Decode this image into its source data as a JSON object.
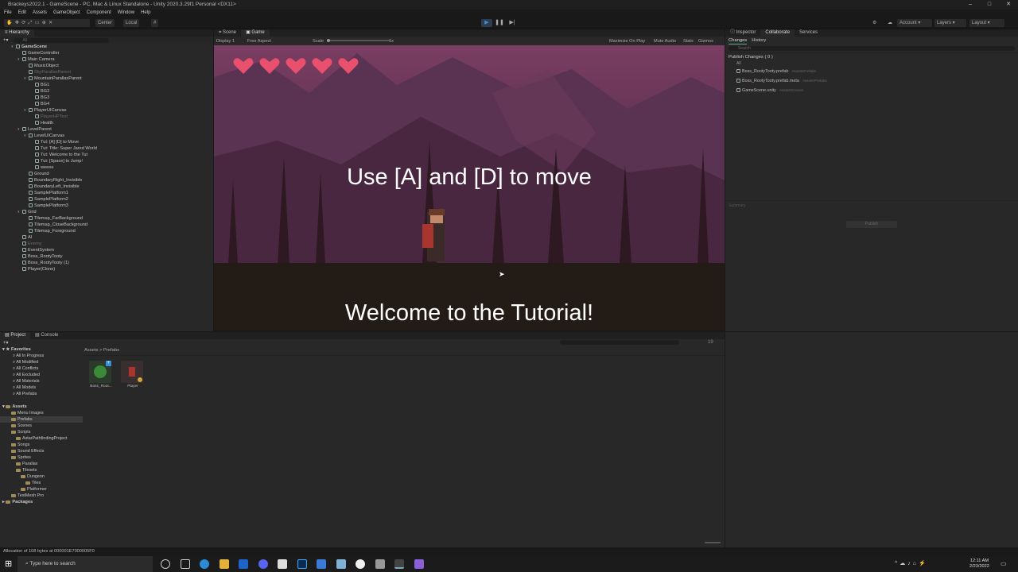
{
  "window": {
    "title": "Brackeys2022.1 - GameScene - PC, Mac & Linux Standalone - Unity 2020.3.29f1 Personal <DX11>",
    "controls": [
      "–",
      "□",
      "✕"
    ]
  },
  "menu": [
    "File",
    "Edit",
    "Assets",
    "GameObject",
    "Component",
    "Window",
    "Help"
  ],
  "toolbar": {
    "pivot": "Center",
    "space": "Local",
    "account": "Account",
    "layers": "Layers",
    "layout": "Layout"
  },
  "hierarchy": {
    "tab": "Hierarchy",
    "search_placeholder": "All",
    "items": [
      {
        "label": "GameScene",
        "indent": 0,
        "kind": "scene",
        "dim": false
      },
      {
        "label": "GameController",
        "indent": 1,
        "kind": "obj",
        "dim": false
      },
      {
        "label": "Main Camera",
        "indent": 1,
        "kind": "obj",
        "dim": false,
        "caret": true
      },
      {
        "label": "MusicObject",
        "indent": 2,
        "kind": "obj",
        "dim": false
      },
      {
        "label": "SkyParallaxParent",
        "indent": 2,
        "kind": "obj",
        "dim": true
      },
      {
        "label": "MountainParallaxParent",
        "indent": 2,
        "kind": "obj",
        "dim": false,
        "caret": true
      },
      {
        "label": "BG1",
        "indent": 3,
        "kind": "obj",
        "dim": false
      },
      {
        "label": "BG2",
        "indent": 3,
        "kind": "obj",
        "dim": false
      },
      {
        "label": "BG3",
        "indent": 3,
        "kind": "obj",
        "dim": false
      },
      {
        "label": "BG4",
        "indent": 3,
        "kind": "obj",
        "dim": false
      },
      {
        "label": "PlayerUICanvas",
        "indent": 2,
        "kind": "obj",
        "dim": false,
        "caret": true
      },
      {
        "label": "PlayerHPText",
        "indent": 3,
        "kind": "obj",
        "dim": true
      },
      {
        "label": "Health",
        "indent": 3,
        "kind": "obj",
        "dim": false
      },
      {
        "label": "LevelParent",
        "indent": 1,
        "kind": "obj",
        "dim": false,
        "caret": true
      },
      {
        "label": "LevelUICanvas",
        "indent": 2,
        "kind": "obj",
        "dim": false,
        "caret": true
      },
      {
        "label": "Tut: [A] [D] to Move",
        "indent": 3,
        "kind": "obj",
        "dim": false
      },
      {
        "label": "Tut: Title: Super Jared World",
        "indent": 3,
        "kind": "obj",
        "dim": false
      },
      {
        "label": "Tut: Welcome to the Tut",
        "indent": 3,
        "kind": "obj",
        "dim": false
      },
      {
        "label": "Tut: [Space] to Jump!",
        "indent": 3,
        "kind": "obj",
        "dim": false
      },
      {
        "label": "weeee",
        "indent": 3,
        "kind": "obj",
        "dim": false
      },
      {
        "label": "Ground",
        "indent": 2,
        "kind": "obj",
        "dim": false
      },
      {
        "label": "BoundaryRight_Invisible",
        "indent": 2,
        "kind": "obj",
        "dim": false
      },
      {
        "label": "BoundaryLeft_Invisible",
        "indent": 2,
        "kind": "obj",
        "dim": false
      },
      {
        "label": "SamplePlatform1",
        "indent": 2,
        "kind": "obj",
        "dim": false
      },
      {
        "label": "SamplePlatform2",
        "indent": 2,
        "kind": "obj",
        "dim": false
      },
      {
        "label": "SamplePlatform3",
        "indent": 2,
        "kind": "obj",
        "dim": false
      },
      {
        "label": "Grid",
        "indent": 1,
        "kind": "obj",
        "dim": false,
        "caret": true
      },
      {
        "label": "Tilemap_FarBackground",
        "indent": 2,
        "kind": "obj",
        "dim": false
      },
      {
        "label": "Tilemap_CloseBackground",
        "indent": 2,
        "kind": "obj",
        "dim": false
      },
      {
        "label": "Tilemap_Foreground",
        "indent": 2,
        "kind": "obj",
        "dim": false
      },
      {
        "label": "AI",
        "indent": 1,
        "kind": "obj",
        "dim": false
      },
      {
        "label": "Enemy",
        "indent": 1,
        "kind": "obj",
        "dim": true
      },
      {
        "label": "EventSystem",
        "indent": 1,
        "kind": "obj",
        "dim": false
      },
      {
        "label": "Boss_RootyTooty",
        "indent": 1,
        "kind": "obj",
        "dim": false
      },
      {
        "label": "Boss_RootyTooty (1)",
        "indent": 1,
        "kind": "obj",
        "dim": false
      },
      {
        "label": "Player(Clone)",
        "indent": 1,
        "kind": "obj",
        "dim": false
      }
    ]
  },
  "view_tabs": [
    "Scene",
    "Game"
  ],
  "game_bar": {
    "display": "Display 1",
    "aspect": "Free Aspect",
    "scale_label": "Scale",
    "scale_value": "1x",
    "maximize": "Maximize On Play",
    "mute": "Mute Audio",
    "stats": "Stats",
    "gizmos": "Gizmos"
  },
  "game": {
    "line1": "Use [A] and [D] to move",
    "line2": "Welcome to the Tutorial!",
    "hearts": 5
  },
  "inspector": {
    "tabs": [
      "Inspector",
      "Collaborate",
      "Services"
    ],
    "subtabs": [
      "Changes",
      "History"
    ],
    "search_placeholder": "Search",
    "publish": "Publish Changes ( 0 )",
    "all": "All",
    "files": [
      {
        "name": "Boss_RootyTooty.prefab",
        "path": "Assets\\Prefabs"
      },
      {
        "name": "Boss_RootyTooty.prefab.meta",
        "path": "Assets\\Prefabs"
      },
      {
        "name": "GameScene.unity",
        "path": "Assets\\Scenes"
      }
    ],
    "summary": "Summary",
    "publish_btn": "Publish"
  },
  "project": {
    "tabs": [
      "Project",
      "Console"
    ],
    "breadcrumb": [
      "Assets",
      "Prefabs"
    ],
    "favorites_label": "Favorites",
    "favorites": [
      "All In Progress",
      "All Modified",
      "All Conflicts",
      "All Excluded",
      "All Materials",
      "All Models",
      "All Prefabs"
    ],
    "assets_label": "Assets",
    "folders": [
      {
        "label": "Menu Images",
        "indent": 1
      },
      {
        "label": "Prefabs",
        "indent": 1
      },
      {
        "label": "Scenes",
        "indent": 1
      },
      {
        "label": "Scripts",
        "indent": 1
      },
      {
        "label": "AstarPathfindingProject",
        "indent": 2
      },
      {
        "label": "Songs",
        "indent": 1
      },
      {
        "label": "Sound Effects",
        "indent": 1
      },
      {
        "label": "Sprites",
        "indent": 1
      },
      {
        "label": "Parallax",
        "indent": 2
      },
      {
        "label": "Tilesets",
        "indent": 2
      },
      {
        "label": "Dungeon",
        "indent": 3
      },
      {
        "label": "Tiles",
        "indent": 4
      },
      {
        "label": "Platformer",
        "indent": 3
      },
      {
        "label": "TextMesh Pro",
        "indent": 1
      }
    ],
    "packages_label": "Packages",
    "assets_grid": [
      {
        "label": "Boss_Root..."
      },
      {
        "label": "Player"
      }
    ],
    "badge_count": "19"
  },
  "status": "Allocation of 108 bytes at 000001E7000005F0",
  "taskbar": {
    "search": "Type here to search",
    "time": "12:11 AM",
    "date": "2/23/2022"
  }
}
